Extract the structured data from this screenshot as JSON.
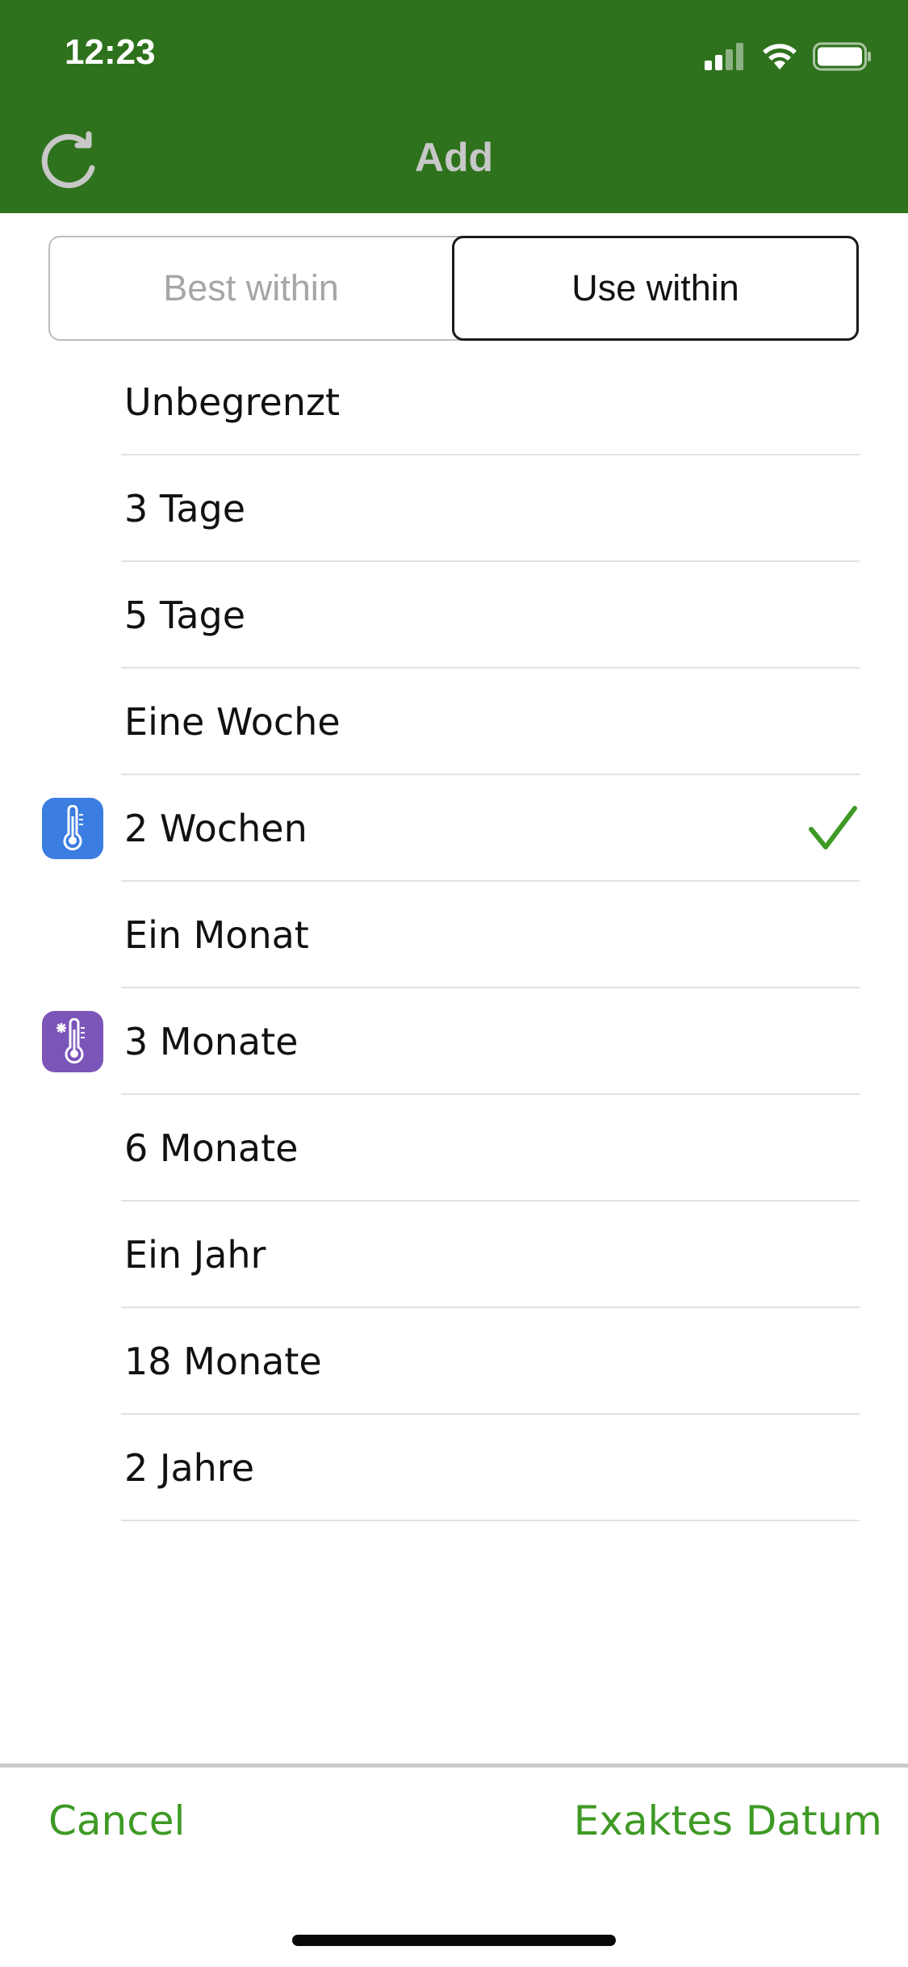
{
  "status_bar": {
    "time": "12:23",
    "icons": [
      "signal-icon",
      "wifi-icon",
      "battery-icon"
    ]
  },
  "header": {
    "title": "Add",
    "refresh_icon": "refresh-icon"
  },
  "segmented": {
    "options": [
      "Best within",
      "Use within"
    ],
    "selected": "Use within"
  },
  "list": {
    "items": [
      {
        "label": "Unbegrenzt"
      },
      {
        "label": "3 Tage"
      },
      {
        "label": "5 Tage"
      },
      {
        "label": "Eine Woche"
      },
      {
        "label": "2 Wochen",
        "icon": "fridge-thermometer-icon",
        "selected": true
      },
      {
        "label": "Ein Monat"
      },
      {
        "label": "3 Monate",
        "icon": "freezer-thermometer-icon"
      },
      {
        "label": "6 Monate"
      },
      {
        "label": "Ein Jahr"
      },
      {
        "label": "18 Monate"
      },
      {
        "label": "2 Jahre"
      }
    ]
  },
  "footer": {
    "cancel": "Cancel",
    "exact_date": "Exaktes Datum"
  },
  "colors": {
    "header_bg": "#2f721d",
    "accent": "#3e9a25",
    "fridge": "#3b7de0",
    "freezer": "#7b55b8"
  }
}
